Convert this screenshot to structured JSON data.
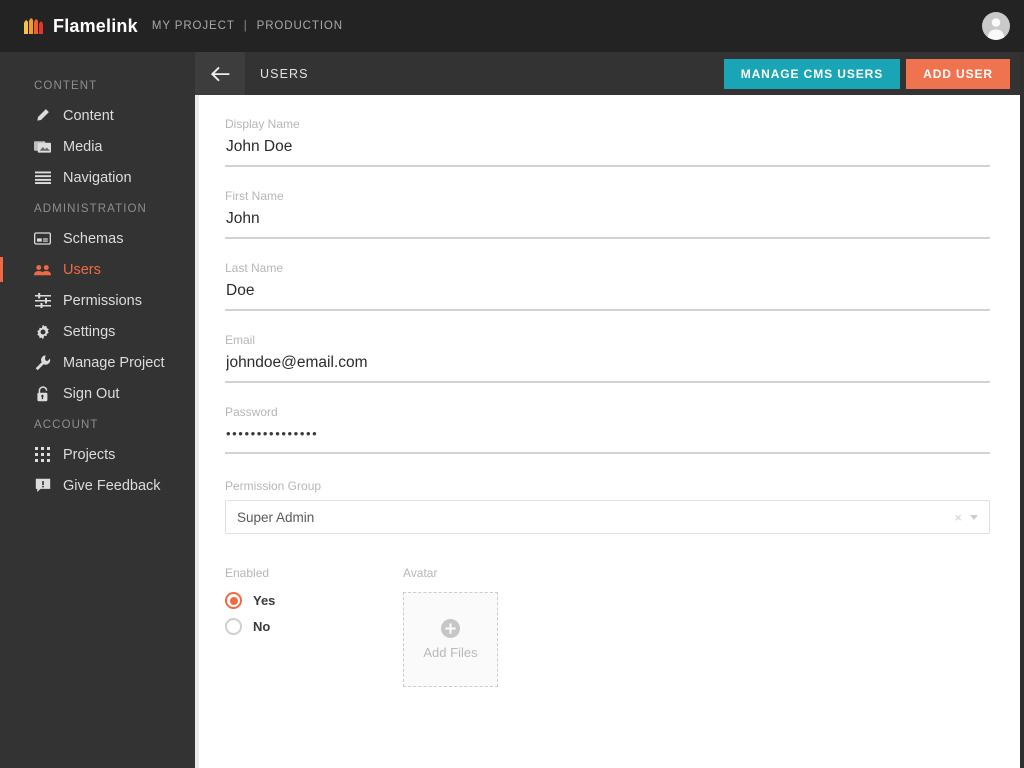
{
  "topbar": {
    "brand_name": "Flamelink",
    "project": "MY PROJECT",
    "separator": "|",
    "environment": "PRODUCTION",
    "avatar_icon": "user-avatar-icon",
    "logo_icon": "flame-logo-icon"
  },
  "sidebar": {
    "sections": [
      {
        "title": "CONTENT",
        "items": [
          {
            "label": "Content",
            "icon": "pencil-icon",
            "active": false
          },
          {
            "label": "Media",
            "icon": "media-folder-icon",
            "active": false
          },
          {
            "label": "Navigation",
            "icon": "hamburger-icon",
            "active": false
          }
        ]
      },
      {
        "title": "ADMINISTRATION",
        "items": [
          {
            "label": "Schemas",
            "icon": "schema-card-icon",
            "active": false
          },
          {
            "label": "Users",
            "icon": "users-icon",
            "active": true
          },
          {
            "label": "Permissions",
            "icon": "sliders-icon",
            "active": false
          },
          {
            "label": "Settings",
            "icon": "gear-icon",
            "active": false
          },
          {
            "label": "Manage Project",
            "icon": "wrench-icon",
            "active": false
          },
          {
            "label": "Sign Out",
            "icon": "lock-icon",
            "active": false
          }
        ]
      },
      {
        "title": "ACCOUNT",
        "items": [
          {
            "label": "Projects",
            "icon": "grid-icon",
            "active": false
          },
          {
            "label": "Give Feedback",
            "icon": "comment-icon",
            "active": false
          }
        ]
      }
    ]
  },
  "toolbar": {
    "back_icon": "arrow-left-icon",
    "title": "USERS",
    "manage_cms_users_label": "MANAGE CMS USERS",
    "add_user_label": "ADD USER"
  },
  "form": {
    "fields": [
      {
        "label": "Display Name",
        "value": "John Doe",
        "placeholder": ""
      },
      {
        "label": "First Name",
        "value": "John",
        "placeholder": ""
      },
      {
        "label": "Last Name",
        "value": "Doe",
        "placeholder": ""
      },
      {
        "label": "Email",
        "value": "johndoe@email.com",
        "placeholder": ""
      }
    ],
    "password": {
      "label": "Password",
      "value": "•••••••••••••••"
    },
    "permission_group": {
      "label": "Permission Group",
      "value": "Super Admin",
      "clear_glyph": "×"
    },
    "enabled": {
      "label": "Enabled",
      "options": [
        {
          "label": "Yes",
          "selected": true
        },
        {
          "label": "No",
          "selected": false
        }
      ]
    },
    "avatar": {
      "label": "Avatar",
      "dropzone_label": "Add Files",
      "plus_icon": "plus-circle-icon"
    }
  },
  "colors": {
    "accent_orange": "#ef6a43",
    "button_orange": "#f0734f",
    "button_teal": "#19a5b5",
    "sidebar_bg": "#333333",
    "topbar_bg": "#232323"
  }
}
